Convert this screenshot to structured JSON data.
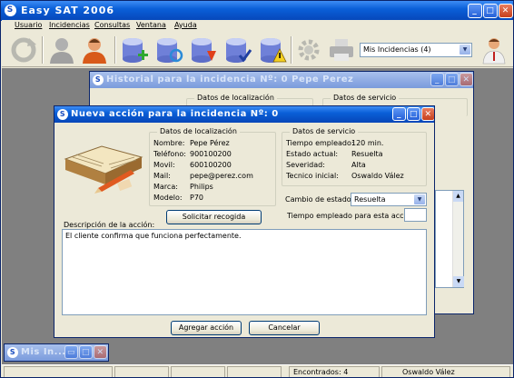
{
  "app": {
    "title": "Easy SAT 2006"
  },
  "menu": [
    "Usuario",
    "Incidencias",
    "Consultas",
    "Ventana",
    "Ayuda"
  ],
  "toolbar": {
    "view_select": "Mis Incidencias (4)"
  },
  "historial": {
    "title": "Historial para la incidencia Nº: 0 Pepe Perez",
    "group_loc": "Datos de localización",
    "group_serv": "Datos de servicio"
  },
  "dialog": {
    "title": "Nueva acción para la incidencia Nº: 0",
    "loc_group_title": "Datos de localización",
    "loc": [
      {
        "label": "Nombre:",
        "value": "Pepe Pérez"
      },
      {
        "label": "Teléfono:",
        "value": "900100200"
      },
      {
        "label": "Movil:",
        "value": "600100200"
      },
      {
        "label": "Mail:",
        "value": "pepe@perez.com"
      },
      {
        "label": "Marca:",
        "value": "Philips"
      },
      {
        "label": "Modelo:",
        "value": "P70"
      }
    ],
    "serv_group_title": "Datos de servicio",
    "serv": [
      {
        "label": "Tiempo empleado:",
        "value": "120 min."
      },
      {
        "label": "Estado actual:",
        "value": "Resuelta"
      },
      {
        "label": "Severidad:",
        "value": "Alta"
      },
      {
        "label": "Tecnico inicial:",
        "value": "Oswaldo Vález"
      }
    ],
    "solicitar_btn": "Solicitar recogida",
    "cambio_label": "Cambio de estado a:",
    "cambio_value": "Resuelta",
    "tiempo_label": "Tiempo empleado para esta acción:",
    "tiempo_value": "",
    "desc_label": "Descripción de la acción:",
    "desc_text": "El cliente confirma que funciona perfectamente.",
    "agregar_btn": "Agregar acción",
    "cancelar_btn": "Cancelar"
  },
  "minimized": {
    "title": "Mis In..."
  },
  "status": {
    "found": "Encontrados: 4",
    "user": "Oswaldo Vález"
  }
}
